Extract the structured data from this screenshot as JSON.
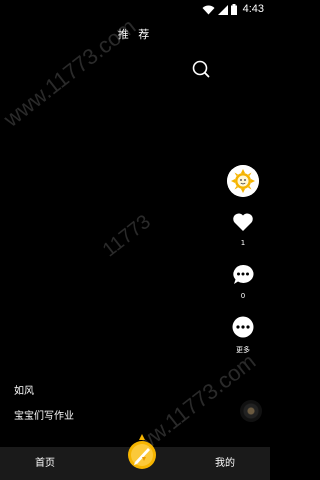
{
  "status_bar": {
    "time": "4:43"
  },
  "header": {
    "title": "推 荐"
  },
  "watermark": {
    "text": "www.11773.com",
    "text_center": "11773"
  },
  "actions": {
    "like_count": "1",
    "comment_count": "0",
    "more_label": "更多"
  },
  "video": {
    "author": "如风",
    "description": "宝宝们写作业"
  },
  "bottom_nav": {
    "home_label": "首页",
    "mine_label": "我的"
  },
  "colors": {
    "background": "#000000",
    "nav_background": "#1a1a1a",
    "accent": "#f5b400"
  }
}
